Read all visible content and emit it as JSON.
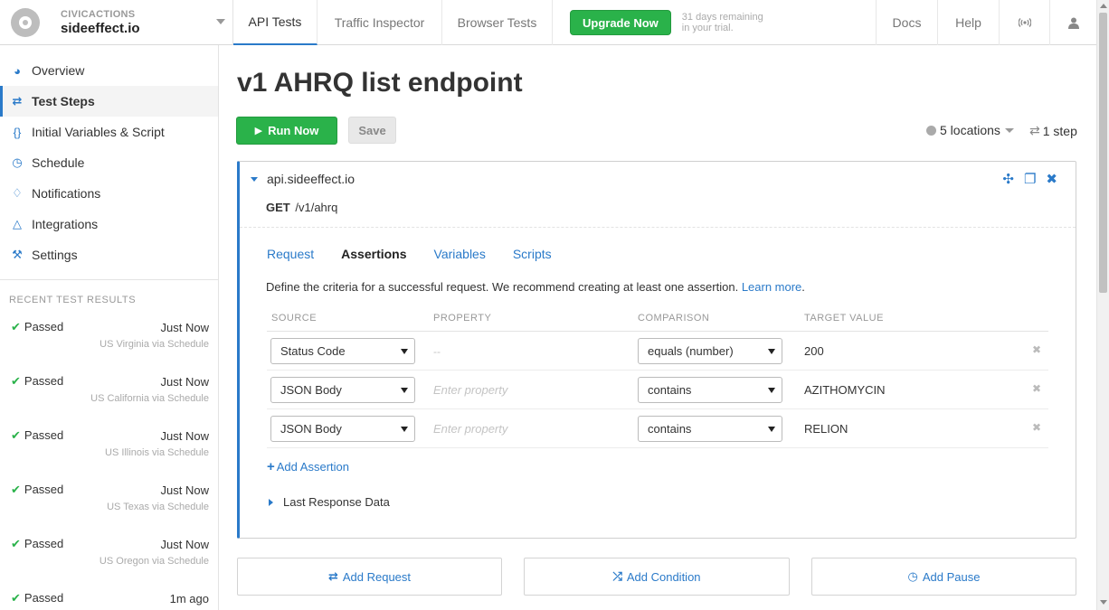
{
  "brand": {
    "org": "CIVICACTIONS",
    "site": "sideeffect.io"
  },
  "topnav": {
    "tabs": [
      {
        "label": "API Tests"
      },
      {
        "label": "Traffic Inspector"
      },
      {
        "label": "Browser Tests"
      }
    ],
    "upgrade_label": "Upgrade Now",
    "trial_line1": "31 days remaining",
    "trial_line2": "in your trial.",
    "docs": "Docs",
    "help": "Help"
  },
  "sidebar": {
    "items": [
      {
        "label": "Overview",
        "icon": "dashboard-icon"
      },
      {
        "label": "Test Steps",
        "icon": "exchange-icon"
      },
      {
        "label": "Initial Variables & Script",
        "icon": "braces-icon"
      },
      {
        "label": "Schedule",
        "icon": "clock-icon"
      },
      {
        "label": "Notifications",
        "icon": "bell-icon"
      },
      {
        "label": "Integrations",
        "icon": "flask-icon"
      },
      {
        "label": "Settings",
        "icon": "wrench-icon"
      }
    ],
    "recent_header": "RECENT TEST RESULTS",
    "results": [
      {
        "status": "Passed",
        "when": "Just Now",
        "where": "US Virginia via Schedule"
      },
      {
        "status": "Passed",
        "when": "Just Now",
        "where": "US California via Schedule"
      },
      {
        "status": "Passed",
        "when": "Just Now",
        "where": "US Illinois via Schedule"
      },
      {
        "status": "Passed",
        "when": "Just Now",
        "where": "US Texas via Schedule"
      },
      {
        "status": "Passed",
        "when": "Just Now",
        "where": "US Oregon via Schedule"
      },
      {
        "status": "Passed",
        "when": "1m ago",
        "where": ""
      }
    ]
  },
  "main": {
    "title": "v1 AHRQ list endpoint",
    "run_label": "Run Now",
    "save_label": "Save",
    "locations": "5 locations",
    "steps": "1 step",
    "step": {
      "host": "api.sideeffect.io",
      "method": "GET",
      "path": "/v1/ahrq",
      "subtabs": [
        {
          "label": "Request"
        },
        {
          "label": "Assertions"
        },
        {
          "label": "Variables"
        },
        {
          "label": "Scripts"
        }
      ],
      "assert_desc": "Define the criteria for a successful request. We recommend creating at least one assertion.",
      "learn_more": "Learn more",
      "columns": {
        "source": "SOURCE",
        "property": "PROPERTY",
        "comparison": "COMPARISON",
        "target": "TARGET VALUE"
      },
      "assertions": [
        {
          "source": "Status Code",
          "property": "--",
          "comparison": "equals (number)",
          "target": "200"
        },
        {
          "source": "JSON Body",
          "property_placeholder": "Enter property",
          "comparison": "contains",
          "target": "AZITHOMYCIN"
        },
        {
          "source": "JSON Body",
          "property_placeholder": "Enter property",
          "comparison": "contains",
          "target": "RELION"
        }
      ],
      "add_assertion": "Add Assertion",
      "last_response": "Last Response Data"
    },
    "add_request": "Add Request",
    "add_condition": "Add Condition",
    "add_pause": "Add Pause"
  },
  "colors": {
    "accent": "#2a7ac9",
    "success": "#2ab24a"
  }
}
